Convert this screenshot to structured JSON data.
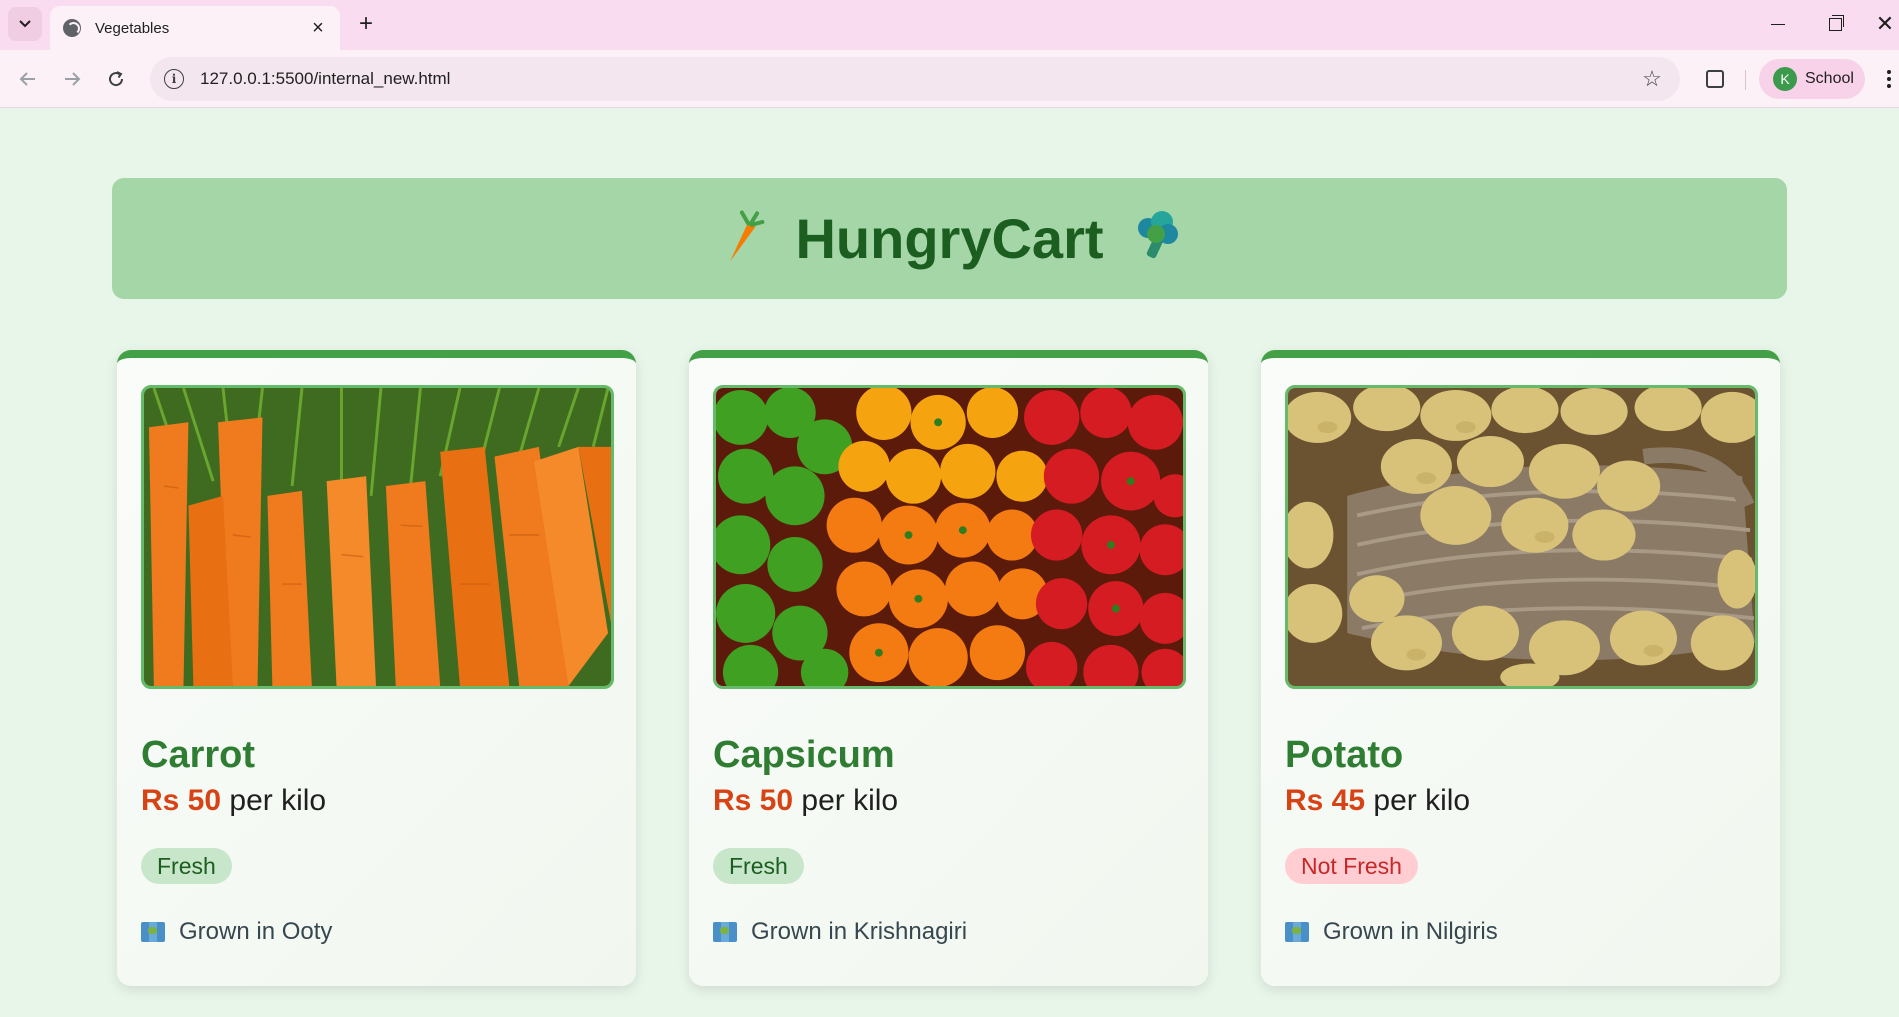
{
  "browser": {
    "tab_title": "Vegetables",
    "url": "127.0.0.1:5500/internal_new.html",
    "profile_initial": "K",
    "profile_name": "School"
  },
  "header": {
    "title": "HungryCart",
    "left_icon": "carrot-emoji",
    "right_icon": "broccoli-emoji"
  },
  "products": [
    {
      "name": "Carrot",
      "price": "Rs 50",
      "unit": "per kilo",
      "status": "Fresh",
      "origin": "Grown in Ooty",
      "image": "carrots-photo"
    },
    {
      "name": "Capsicum",
      "price": "Rs 50",
      "unit": "per kilo",
      "status": "Fresh",
      "origin": "Grown in Krishnagiri",
      "image": "capsicums-photo"
    },
    {
      "name": "Potato",
      "price": "Rs 45",
      "unit": "per kilo",
      "status": "Not Fresh",
      "origin": "Grown in Nilgiris",
      "image": "potatoes-photo"
    }
  ],
  "colors": {
    "page_bg": "#e8f5e9",
    "header_bg": "#a5d6a7",
    "title_green": "#1b5e20",
    "card_accent": "#43a047",
    "price_red": "#d84315",
    "fresh_bg": "#c8e6c9",
    "not_fresh_bg": "#ffcdd2"
  }
}
